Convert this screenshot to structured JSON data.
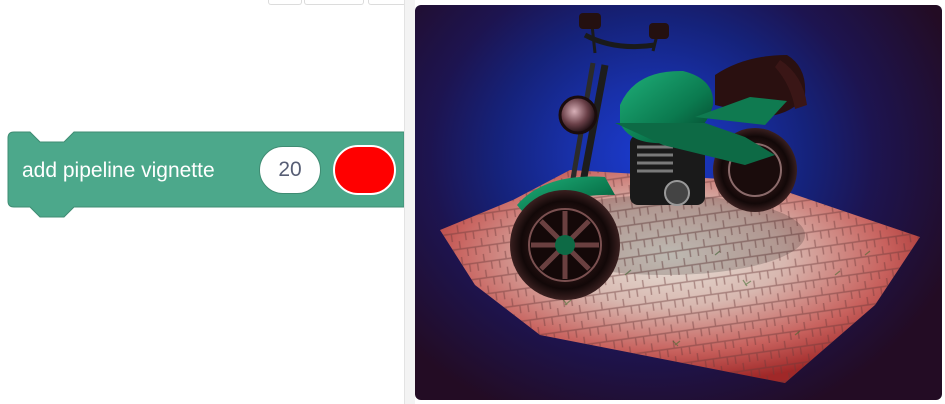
{
  "block": {
    "label": "add pipeline vignette",
    "number_value": "20",
    "color_value": "#ff0000",
    "block_color": "#4ca88b",
    "block_border": "#3f8c73"
  },
  "stage": {
    "description_icon": "motorcycle-scene"
  }
}
